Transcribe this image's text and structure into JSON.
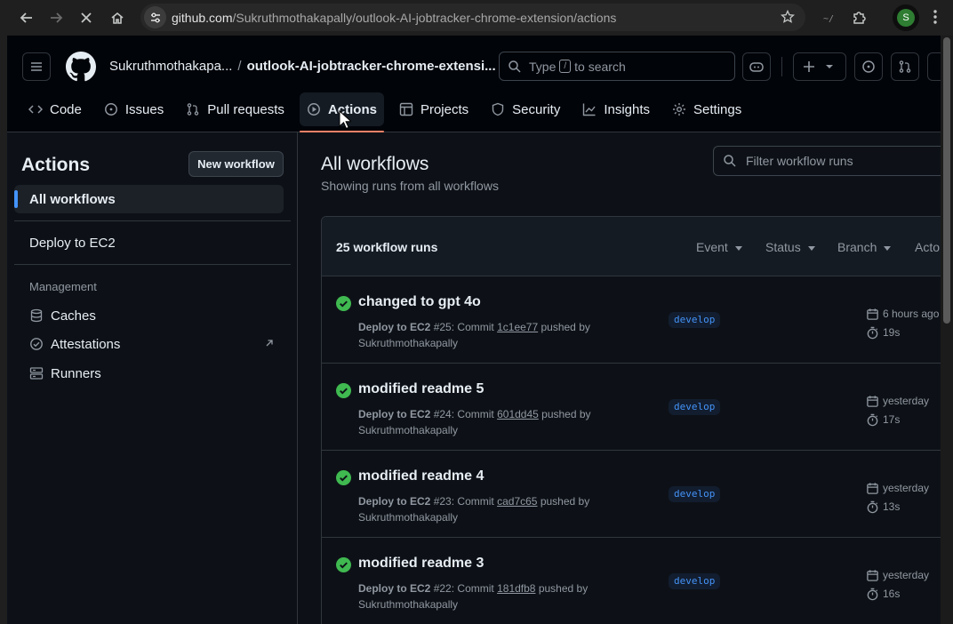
{
  "browser": {
    "url_host": "github.com",
    "url_path": "/Sukruthmothakapally/outlook-AI-jobtracker-chrome-extension/actions",
    "avatar_letter": "S"
  },
  "header": {
    "owner": "Sukruthmothakapa...",
    "separator": "/",
    "repo": "outlook-AI-jobtracker-chrome-extensi...",
    "search_prefix": "Type",
    "search_key": "/",
    "search_suffix": "to search"
  },
  "tabs": [
    {
      "label": "Code",
      "icon": "code-icon"
    },
    {
      "label": "Issues",
      "icon": "issue-icon"
    },
    {
      "label": "Pull requests",
      "icon": "pull-request-icon"
    },
    {
      "label": "Actions",
      "icon": "play-icon",
      "active": true
    },
    {
      "label": "Projects",
      "icon": "table-icon"
    },
    {
      "label": "Security",
      "icon": "shield-icon"
    },
    {
      "label": "Insights",
      "icon": "graph-icon"
    },
    {
      "label": "Settings",
      "icon": "gear-icon"
    }
  ],
  "sidebar": {
    "title": "Actions",
    "new_workflow": "New workflow",
    "all_workflows": "All workflows",
    "workflow": "Deploy to EC2",
    "management_label": "Management",
    "caches": "Caches",
    "attestations": "Attestations",
    "runners": "Runners"
  },
  "main": {
    "title": "All workflows",
    "subtitle": "Showing runs from all workflows",
    "filter_placeholder": "Filter workflow runs",
    "runs_count": "25 workflow runs",
    "filters": [
      "Event",
      "Status",
      "Branch",
      "Acto"
    ]
  },
  "runs": [
    {
      "title": "changed to gpt 4o",
      "workflow": "Deploy to EC2",
      "num": "#25",
      "commit_label": "Commit",
      "commit": "1c1ee77",
      "pushed": "pushed by",
      "user": "Sukruthmothakapally",
      "branch": "develop",
      "when": "6 hours ago",
      "duration": "19s"
    },
    {
      "title": "modified readme 5",
      "workflow": "Deploy to EC2",
      "num": "#24",
      "commit_label": "Commit",
      "commit": "601dd45",
      "pushed": "pushed by",
      "user": "Sukruthmothakapally",
      "branch": "develop",
      "when": "yesterday",
      "duration": "17s"
    },
    {
      "title": "modified readme 4",
      "workflow": "Deploy to EC2",
      "num": "#23",
      "commit_label": "Commit",
      "commit": "cad7c65",
      "pushed": "pushed by",
      "user": "Sukruthmothakapally",
      "branch": "develop",
      "when": "yesterday",
      "duration": "13s"
    },
    {
      "title": "modified readme 3",
      "workflow": "Deploy to EC2",
      "num": "#22",
      "commit_label": "Commit",
      "commit": "181dfb8",
      "pushed": "pushed by",
      "user": "Sukruthmothakapally",
      "branch": "develop",
      "when": "yesterday",
      "duration": "16s"
    }
  ],
  "colors": {
    "accent": "#4493f8",
    "success": "#3fb950",
    "tab_underline": "#f78166"
  }
}
